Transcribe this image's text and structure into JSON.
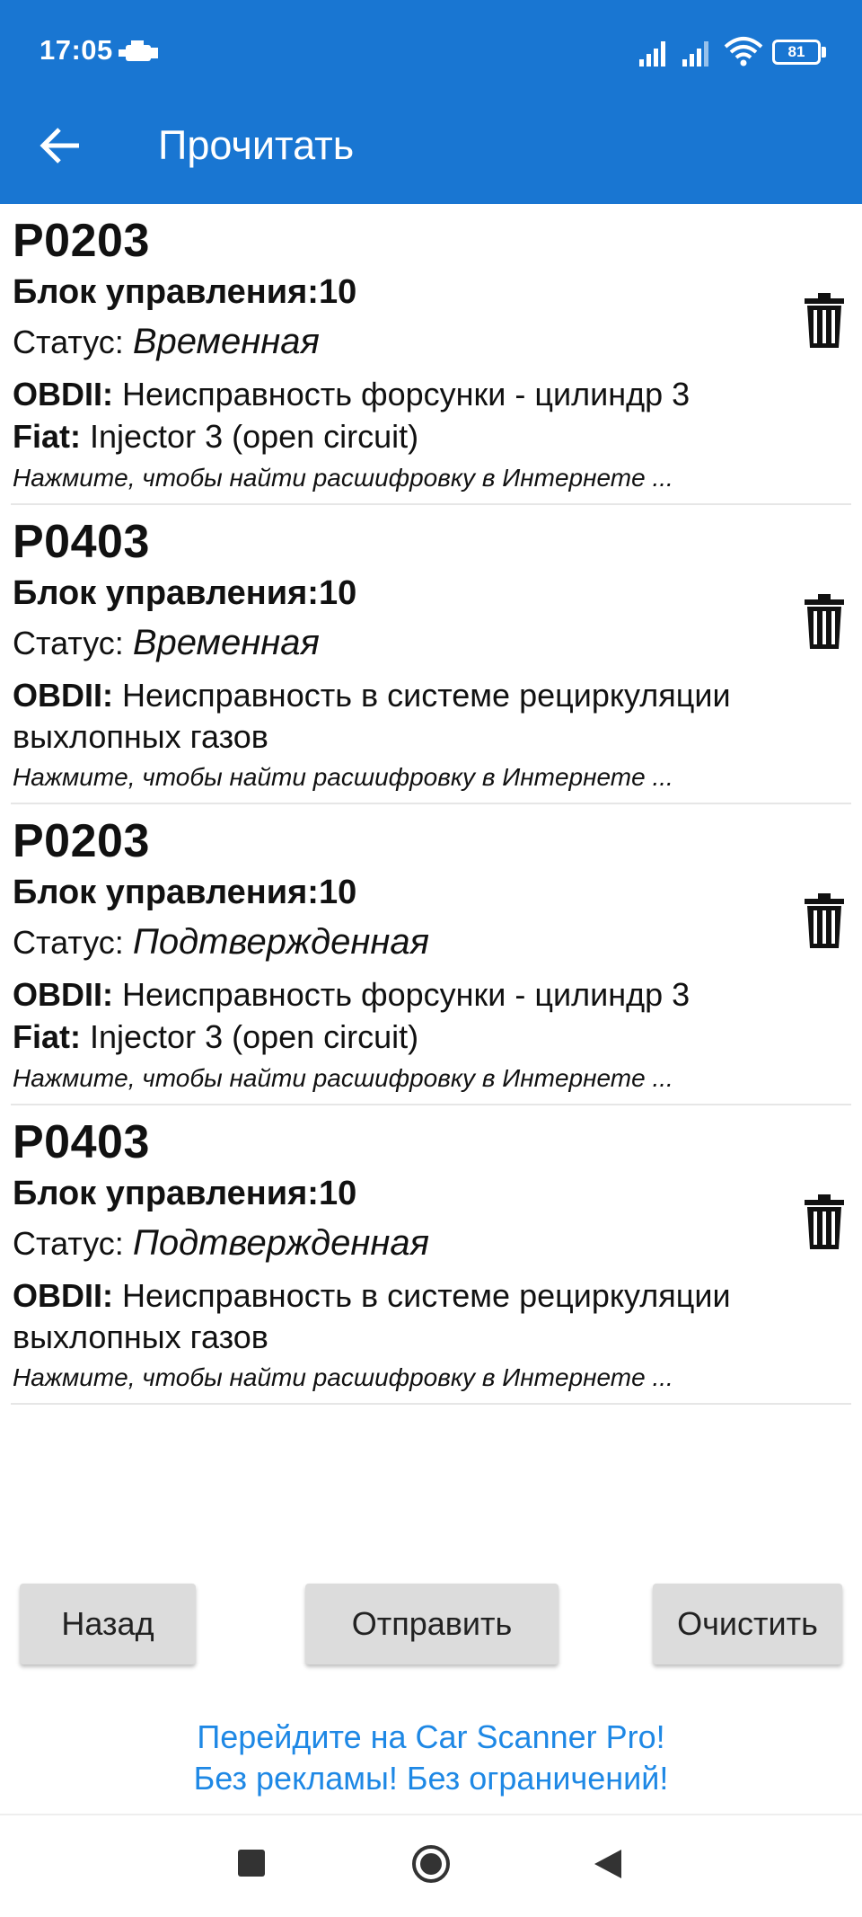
{
  "status_bar": {
    "time": "17:05",
    "battery": "81",
    "icons": [
      "car-engine-icon",
      "signal-icon",
      "signal-icon",
      "wifi-icon",
      "battery-icon"
    ]
  },
  "app_bar": {
    "title": "Прочитать",
    "back_icon": "arrow-left-icon"
  },
  "colors": {
    "primary": "#1976d2",
    "link": "#1e88e5",
    "button_bg": "#dcdcdc"
  },
  "codes": [
    {
      "code": "P0203",
      "block": "Блок управления:10",
      "status_label": "Статус:",
      "status_value": "Временная",
      "desc_label": "OBDII:",
      "desc_text": "Неисправность форсунки - цилиндр 3",
      "fiat_label": "Fiat:",
      "fiat_text": "Injector 3 (open circuit)",
      "hint": "Нажмите, чтобы найти расшифровку в Интернете ..."
    },
    {
      "code": "P0403",
      "block": "Блок управления:10",
      "status_label": "Статус:",
      "status_value": "Временная",
      "desc_label": "OBDII:",
      "desc_text": "Неисправность в системе рециркуляции выхлопных газов",
      "hint": "Нажмите, чтобы найти расшифровку в Интернете ..."
    },
    {
      "code": "P0203",
      "block": "Блок управления:10",
      "status_label": "Статус:",
      "status_value": "Подтвержденная",
      "desc_label": "OBDII:",
      "desc_text": "Неисправность форсунки - цилиндр 3",
      "fiat_label": "Fiat:",
      "fiat_text": "Injector 3 (open circuit)",
      "hint": "Нажмите, чтобы найти расшифровку в Интернете ..."
    },
    {
      "code": "P0403",
      "block": "Блок управления:10",
      "status_label": "Статус:",
      "status_value": "Подтвержденная",
      "desc_label": "OBDII:",
      "desc_text": "Неисправность в системе рециркуляции выхлопных газов",
      "hint": "Нажмите, чтобы найти расшифровку в Интернете ..."
    }
  ],
  "buttons": {
    "back": "Назад",
    "send": "Отправить",
    "clear": "Очистить"
  },
  "promo": {
    "line1": "Перейдите на Car Scanner Pro!",
    "line2": "Без рекламы! Без ограничений!"
  }
}
